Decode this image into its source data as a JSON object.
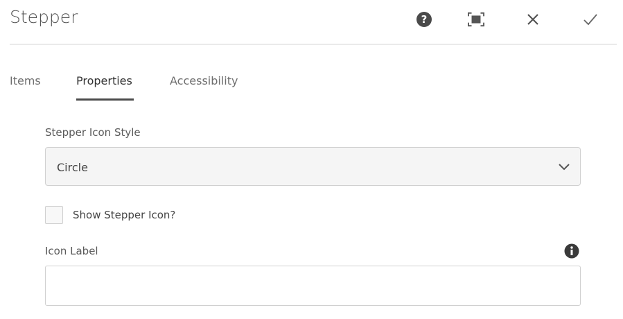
{
  "header": {
    "title": "Stepper"
  },
  "tabs": [
    {
      "label": "Items"
    },
    {
      "label": "Properties",
      "active": true
    },
    {
      "label": "Accessibility"
    }
  ],
  "form": {
    "icon_style": {
      "label": "Stepper Icon Style",
      "value": "Circle"
    },
    "show_icon": {
      "label": "Show Stepper Icon?",
      "checked": false
    },
    "icon_label": {
      "label": "Icon Label",
      "value": "",
      "placeholder": ""
    }
  }
}
